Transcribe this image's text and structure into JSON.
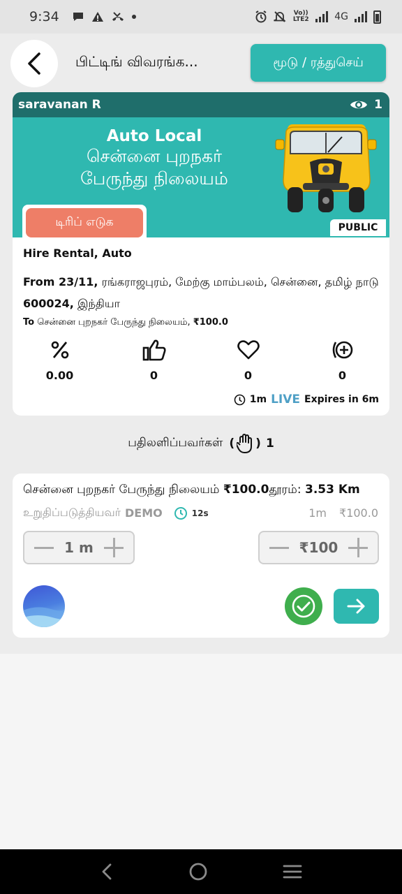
{
  "status_bar": {
    "time": "9:34",
    "volte_label": "Vo)) LTE2",
    "network": "4G"
  },
  "header": {
    "title": "பிட்டிங் விவரங்க...",
    "cancel_label": "மூடு / ரத்துசெய்"
  },
  "trip_card": {
    "user_name": "saravanan R",
    "views": "1",
    "banner_title": "Auto Local",
    "banner_line2": "சென்னை புறநகர்",
    "banner_line3": "பேருந்து நிலையம்",
    "trip_button": "டிரிப் எடுக",
    "visibility": "PUBLIC",
    "service": "Hire Rental, Auto",
    "from_label": "From 23/11,",
    "from_address": " ரங்கராஜபுரம், மேற்கு மாம்பலம், சென்னை, தமிழ் நாடு ",
    "from_pin": "600024,",
    "from_country": " இந்தியா",
    "to_label": "To",
    "to_address": " சென்னை புறநகர் பேருந்து நிலையம், ",
    "to_price": "₹100.0",
    "stats": {
      "percent": "0.00",
      "likes": "0",
      "favorites": "0",
      "adds": "0"
    },
    "elapsed": "1m",
    "live": "LIVE",
    "expires": "Expires in 6m"
  },
  "responders": {
    "label": "பதிலளிப்பவர்கள்",
    "open_paren": "(",
    "close_paren": ")",
    "count": "1"
  },
  "bid_card": {
    "destination": "சென்னை புறநகர் பேருந்து நிலையம் ",
    "price": "₹100.0",
    "distance_label": "தூரம்: ",
    "distance": "3.53 Km",
    "confirmed_label": "உறுதிப்படுத்தியவர்",
    "confirmed_by": "DEMO",
    "timer": "12s",
    "quoted_time": "1m",
    "quoted_price": "₹100.0",
    "time_value": "1 m",
    "price_value": "₹100"
  },
  "colors": {
    "teal": "#2fb8b0",
    "dark_teal": "#1f6e6b",
    "coral": "#ee7e67",
    "green": "#3fae4d",
    "live_blue": "#4fa0c6"
  }
}
